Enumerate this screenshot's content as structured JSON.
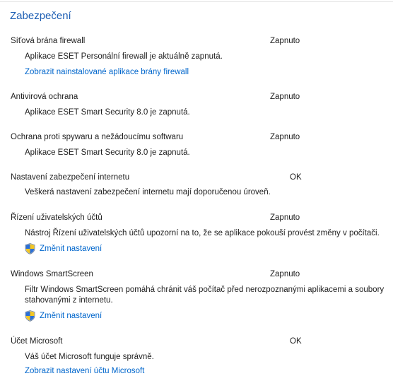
{
  "section": {
    "title": "Zabezpečení"
  },
  "items": [
    {
      "title": "Síťová brána firewall",
      "status": "Zapnuto",
      "description": "Aplikace ESET Personální firewall je aktuálně zapnutá.",
      "link": "Zobrazit nainstalované aplikace brány firewall"
    },
    {
      "title": "Antivirová ochrana",
      "status": "Zapnuto",
      "description": "Aplikace ESET Smart Security 8.0 je zapnutá."
    },
    {
      "title": "Ochrana proti spywaru a nežádoucímu softwaru",
      "status": "Zapnuto",
      "description": "Aplikace ESET Smart Security 8.0 je zapnutá."
    },
    {
      "title": "Nastavení zabezpečení internetu",
      "status": "OK",
      "description": "Veškerá nastavení zabezpečení internetu mají doporučenou úroveň."
    },
    {
      "title": "Řízení uživatelských účtů",
      "status": "Zapnuto",
      "description": "Nástroj Řízení uživatelských účtů upozorní na to, že se aplikace pokouší provést změny v počítači.",
      "link": "Změnit nastavení"
    },
    {
      "title": "Windows SmartScreen",
      "status": "Zapnuto",
      "description_line1": "Filtr Windows SmartScreen pomáhá chránit váš počítač před nerozpoznanými aplikacemi a soubory",
      "description_line2": "stahovanými z internetu.",
      "link": "Změnit nastavení"
    },
    {
      "title": "Účet Microsoft",
      "status": "OK",
      "description": "Váš účet Microsoft funguje správně.",
      "link": "Zobrazit nastavení účtu Microsoft"
    }
  ],
  "colors": {
    "accent": "#1e5fb4",
    "link": "#0066cc",
    "text": "#1e1e1e"
  }
}
